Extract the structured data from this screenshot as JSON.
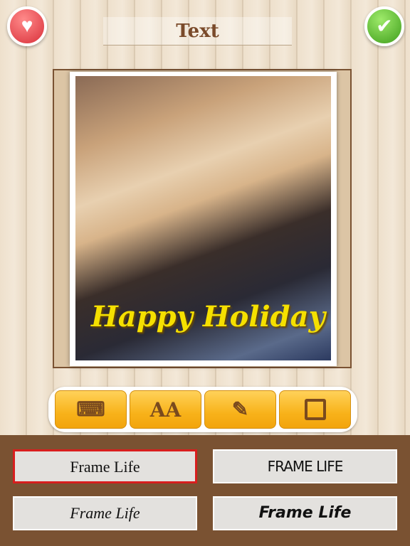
{
  "header": {
    "title": "Text",
    "left_icon": "heart-icon",
    "right_icon": "checkmark-icon"
  },
  "photo": {
    "overlay_text": "Happy Holiday",
    "overlay_color": "#f5e000"
  },
  "toolbar": {
    "items": [
      {
        "icon": "keyboard-icon"
      },
      {
        "icon": "font-size-icon",
        "label": "AA"
      },
      {
        "icon": "eyedropper-icon"
      },
      {
        "icon": "frame-icon"
      }
    ]
  },
  "fonts": {
    "items": [
      {
        "label": "Frame Life",
        "selected": true
      },
      {
        "label": "FRAME LIFE"
      },
      {
        "label": "Frame Life"
      },
      {
        "label": "Frame Life"
      }
    ]
  },
  "colors": {
    "panel": "#7a5232",
    "selected_border": "#d81e1e",
    "toolbar": "#f8b21a"
  }
}
